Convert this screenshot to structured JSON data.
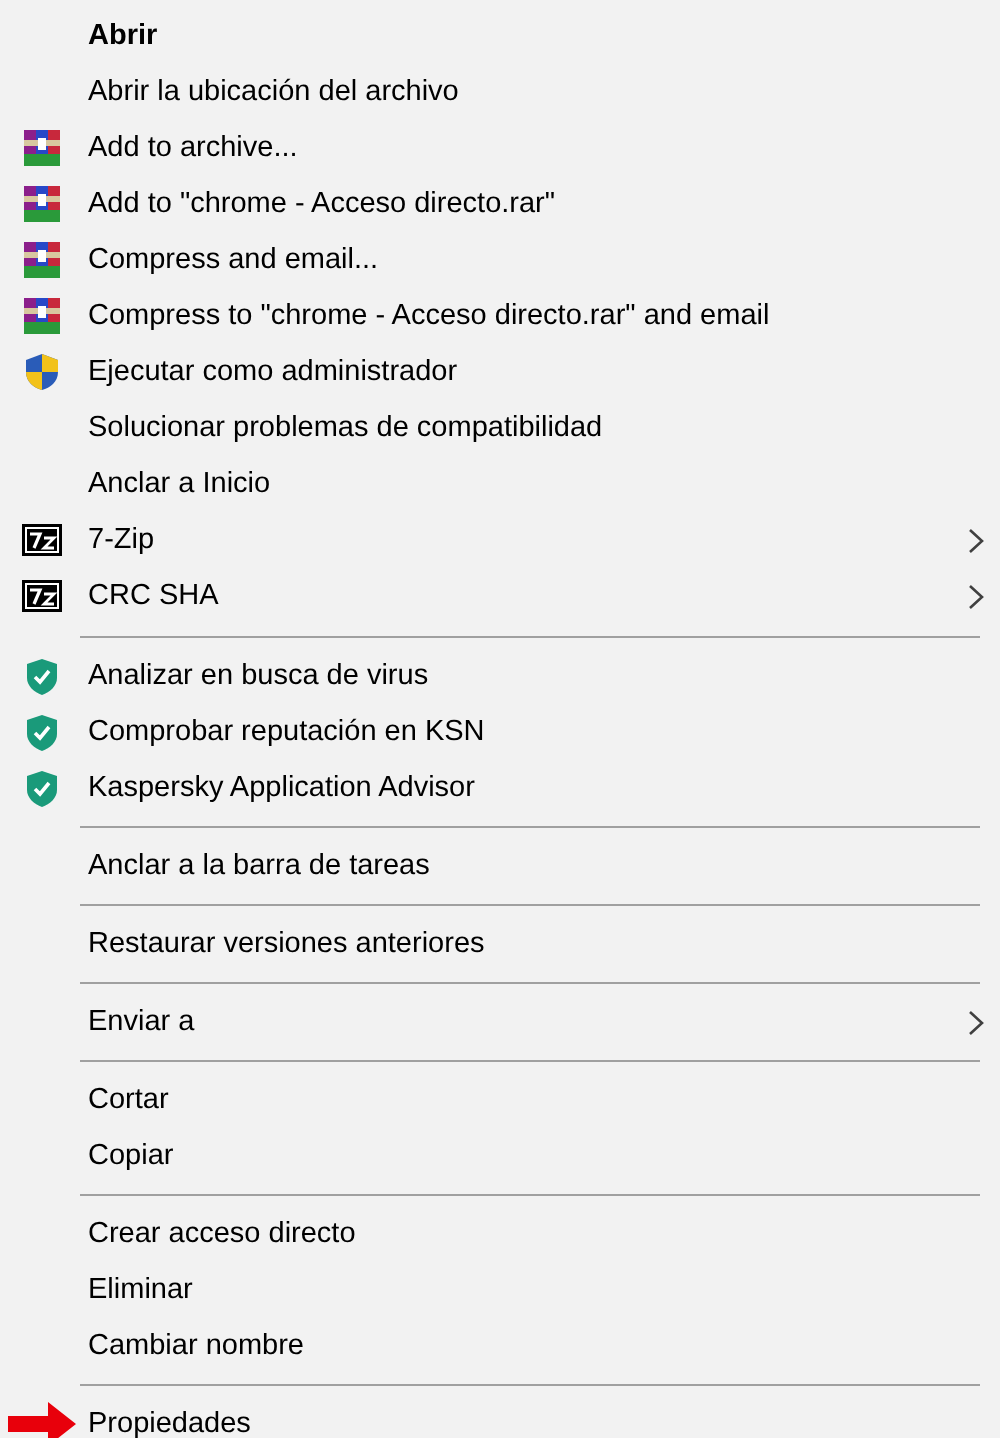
{
  "menu": {
    "groups": [
      {
        "items": [
          {
            "label": "Abrir",
            "default": true
          },
          {
            "label": "Abrir la ubicación del archivo"
          },
          {
            "label": "Add to archive...",
            "kind": "archive"
          },
          {
            "label": "Add to \"chrome - Acceso directo.rar\"",
            "kind": "archive"
          },
          {
            "label": "Compress and email...",
            "kind": "archive"
          },
          {
            "label": "Compress to \"chrome - Acceso directo.rar\" and email",
            "kind": "archive"
          },
          {
            "label": "Ejecutar como administrador",
            "kind": "shield"
          },
          {
            "label": "Solucionar problemas de compatibilidad"
          },
          {
            "label": "Anclar a Inicio"
          },
          {
            "label": "7-Zip",
            "kind": "zip",
            "submenu": true
          },
          {
            "label": "CRC SHA",
            "kind": "zip",
            "submenu": true
          }
        ]
      },
      {
        "items": [
          {
            "label": "Analizar en busca de virus",
            "kind": "antivirus"
          },
          {
            "label": "Comprobar reputación en KSN",
            "kind": "antivirus"
          },
          {
            "label": "Kaspersky Application Advisor",
            "kind": "antivirus"
          }
        ]
      },
      {
        "items": [
          {
            "label": "Anclar a la barra de tareas"
          }
        ]
      },
      {
        "items": [
          {
            "label": "Restaurar versiones anteriores"
          }
        ]
      },
      {
        "items": [
          {
            "label": "Enviar a",
            "submenu": true
          }
        ]
      },
      {
        "items": [
          {
            "label": "Cortar"
          },
          {
            "label": "Copiar"
          }
        ]
      },
      {
        "items": [
          {
            "label": "Crear acceso directo"
          },
          {
            "label": "Eliminar"
          },
          {
            "label": "Cambiar nombre"
          }
        ]
      },
      {
        "items": [
          {
            "label": "Propiedades",
            "pointed": true
          }
        ]
      }
    ]
  }
}
